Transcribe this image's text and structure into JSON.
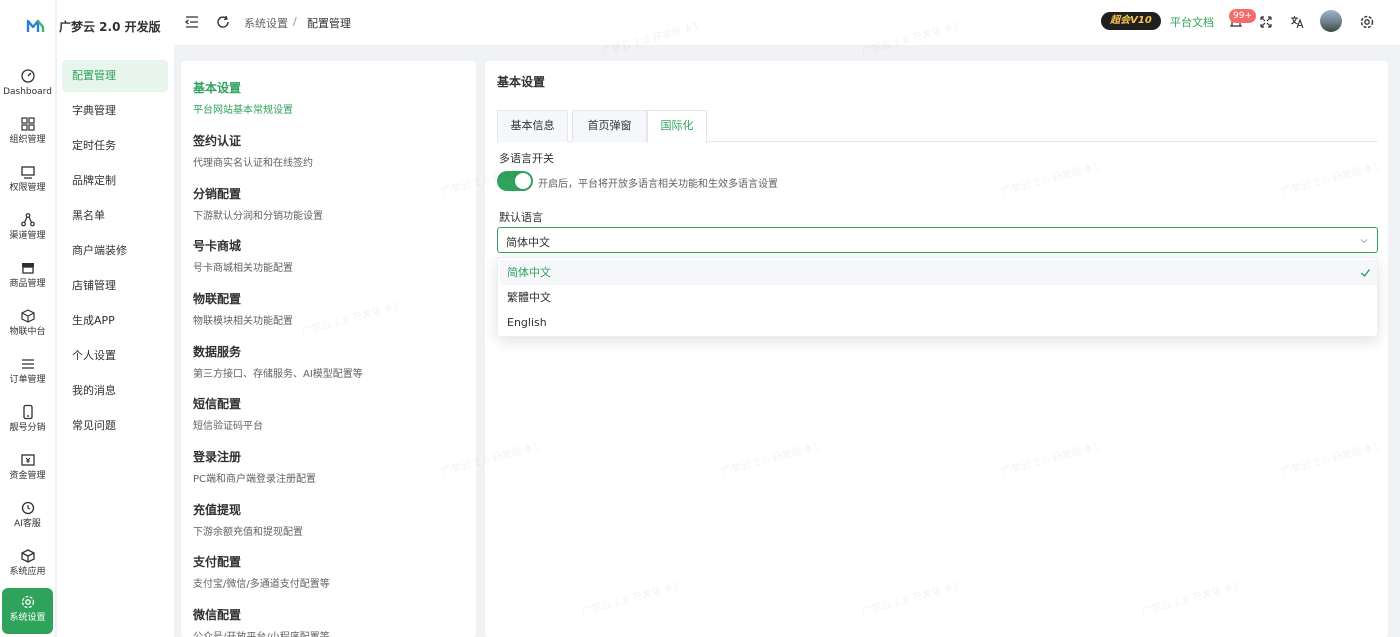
{
  "app": {
    "title": "广梦云 2.0 开发版"
  },
  "rail": [
    {
      "label": "Dashboard",
      "icon": "dashboard-icon"
    },
    {
      "label": "组织管理",
      "icon": "grid-icon"
    },
    {
      "label": "权限管理",
      "icon": "monitor-icon"
    },
    {
      "label": "渠道管理",
      "icon": "share-icon"
    },
    {
      "label": "商品管理",
      "icon": "store-icon"
    },
    {
      "label": "物联中台",
      "icon": "cube-icon"
    },
    {
      "label": "订单管理",
      "icon": "list-icon"
    },
    {
      "label": "靓号分销",
      "icon": "phone-icon"
    },
    {
      "label": "资金管理",
      "icon": "wallet-icon"
    },
    {
      "label": "AI客服",
      "icon": "chat-icon"
    },
    {
      "label": "系统应用",
      "icon": "box-icon"
    },
    {
      "label": "系统设置",
      "icon": "gear-icon",
      "active": true
    }
  ],
  "submenu": [
    {
      "label": "配置管理",
      "active": true
    },
    {
      "label": "字典管理"
    },
    {
      "label": "定时任务"
    },
    {
      "label": "品牌定制"
    },
    {
      "label": "黑名单"
    },
    {
      "label": "商户端装修"
    },
    {
      "label": "店铺管理"
    },
    {
      "label": "生成APP"
    },
    {
      "label": "个人设置"
    },
    {
      "label": "我的消息"
    },
    {
      "label": "常见问题"
    }
  ],
  "header": {
    "breadcrumb": [
      "系统设置",
      "/",
      "配置管理"
    ],
    "vip_label": "超会V10",
    "doc_link": "平台文档",
    "notification_count": "99+"
  },
  "settings_list": [
    {
      "title": "基本设置",
      "desc": "平台网站基本常规设置",
      "active": true
    },
    {
      "title": "签约认证",
      "desc": "代理商实名认证和在线签约"
    },
    {
      "title": "分销配置",
      "desc": "下游默认分润和分销功能设置"
    },
    {
      "title": "号卡商城",
      "desc": "号卡商城相关功能配置"
    },
    {
      "title": "物联配置",
      "desc": "物联模块相关功能配置"
    },
    {
      "title": "数据服务",
      "desc": "第三方接口、存储服务、AI模型配置等"
    },
    {
      "title": "短信配置",
      "desc": "短信验证码平台"
    },
    {
      "title": "登录注册",
      "desc": "PC端和商户端登录注册配置"
    },
    {
      "title": "充值提现",
      "desc": "下游余额充值和提现配置"
    },
    {
      "title": "支付配置",
      "desc": "支付宝/微信/多通道支付配置等"
    },
    {
      "title": "微信配置",
      "desc": "公众号/开放平台/小程序配置等"
    }
  ],
  "main": {
    "title": "基本设置",
    "tabs": [
      {
        "label": "基本信息"
      },
      {
        "label": "首页弹窗"
      },
      {
        "label": "国际化",
        "active": true
      }
    ],
    "multilang": {
      "label": "多语言开关",
      "enabled": true,
      "hint": "开启后，平台将开放多语言相关功能和生效多语言设置"
    },
    "default_lang": {
      "label": "默认语言",
      "value": "简体中文",
      "options": [
        "简体中文",
        "繁體中文",
        "English"
      ],
      "selected_index": 0
    }
  },
  "watermark": "广梦云 2.0 开发版 #1",
  "colors": {
    "accent": "#2fa35b",
    "badge": "#f56c6c"
  }
}
